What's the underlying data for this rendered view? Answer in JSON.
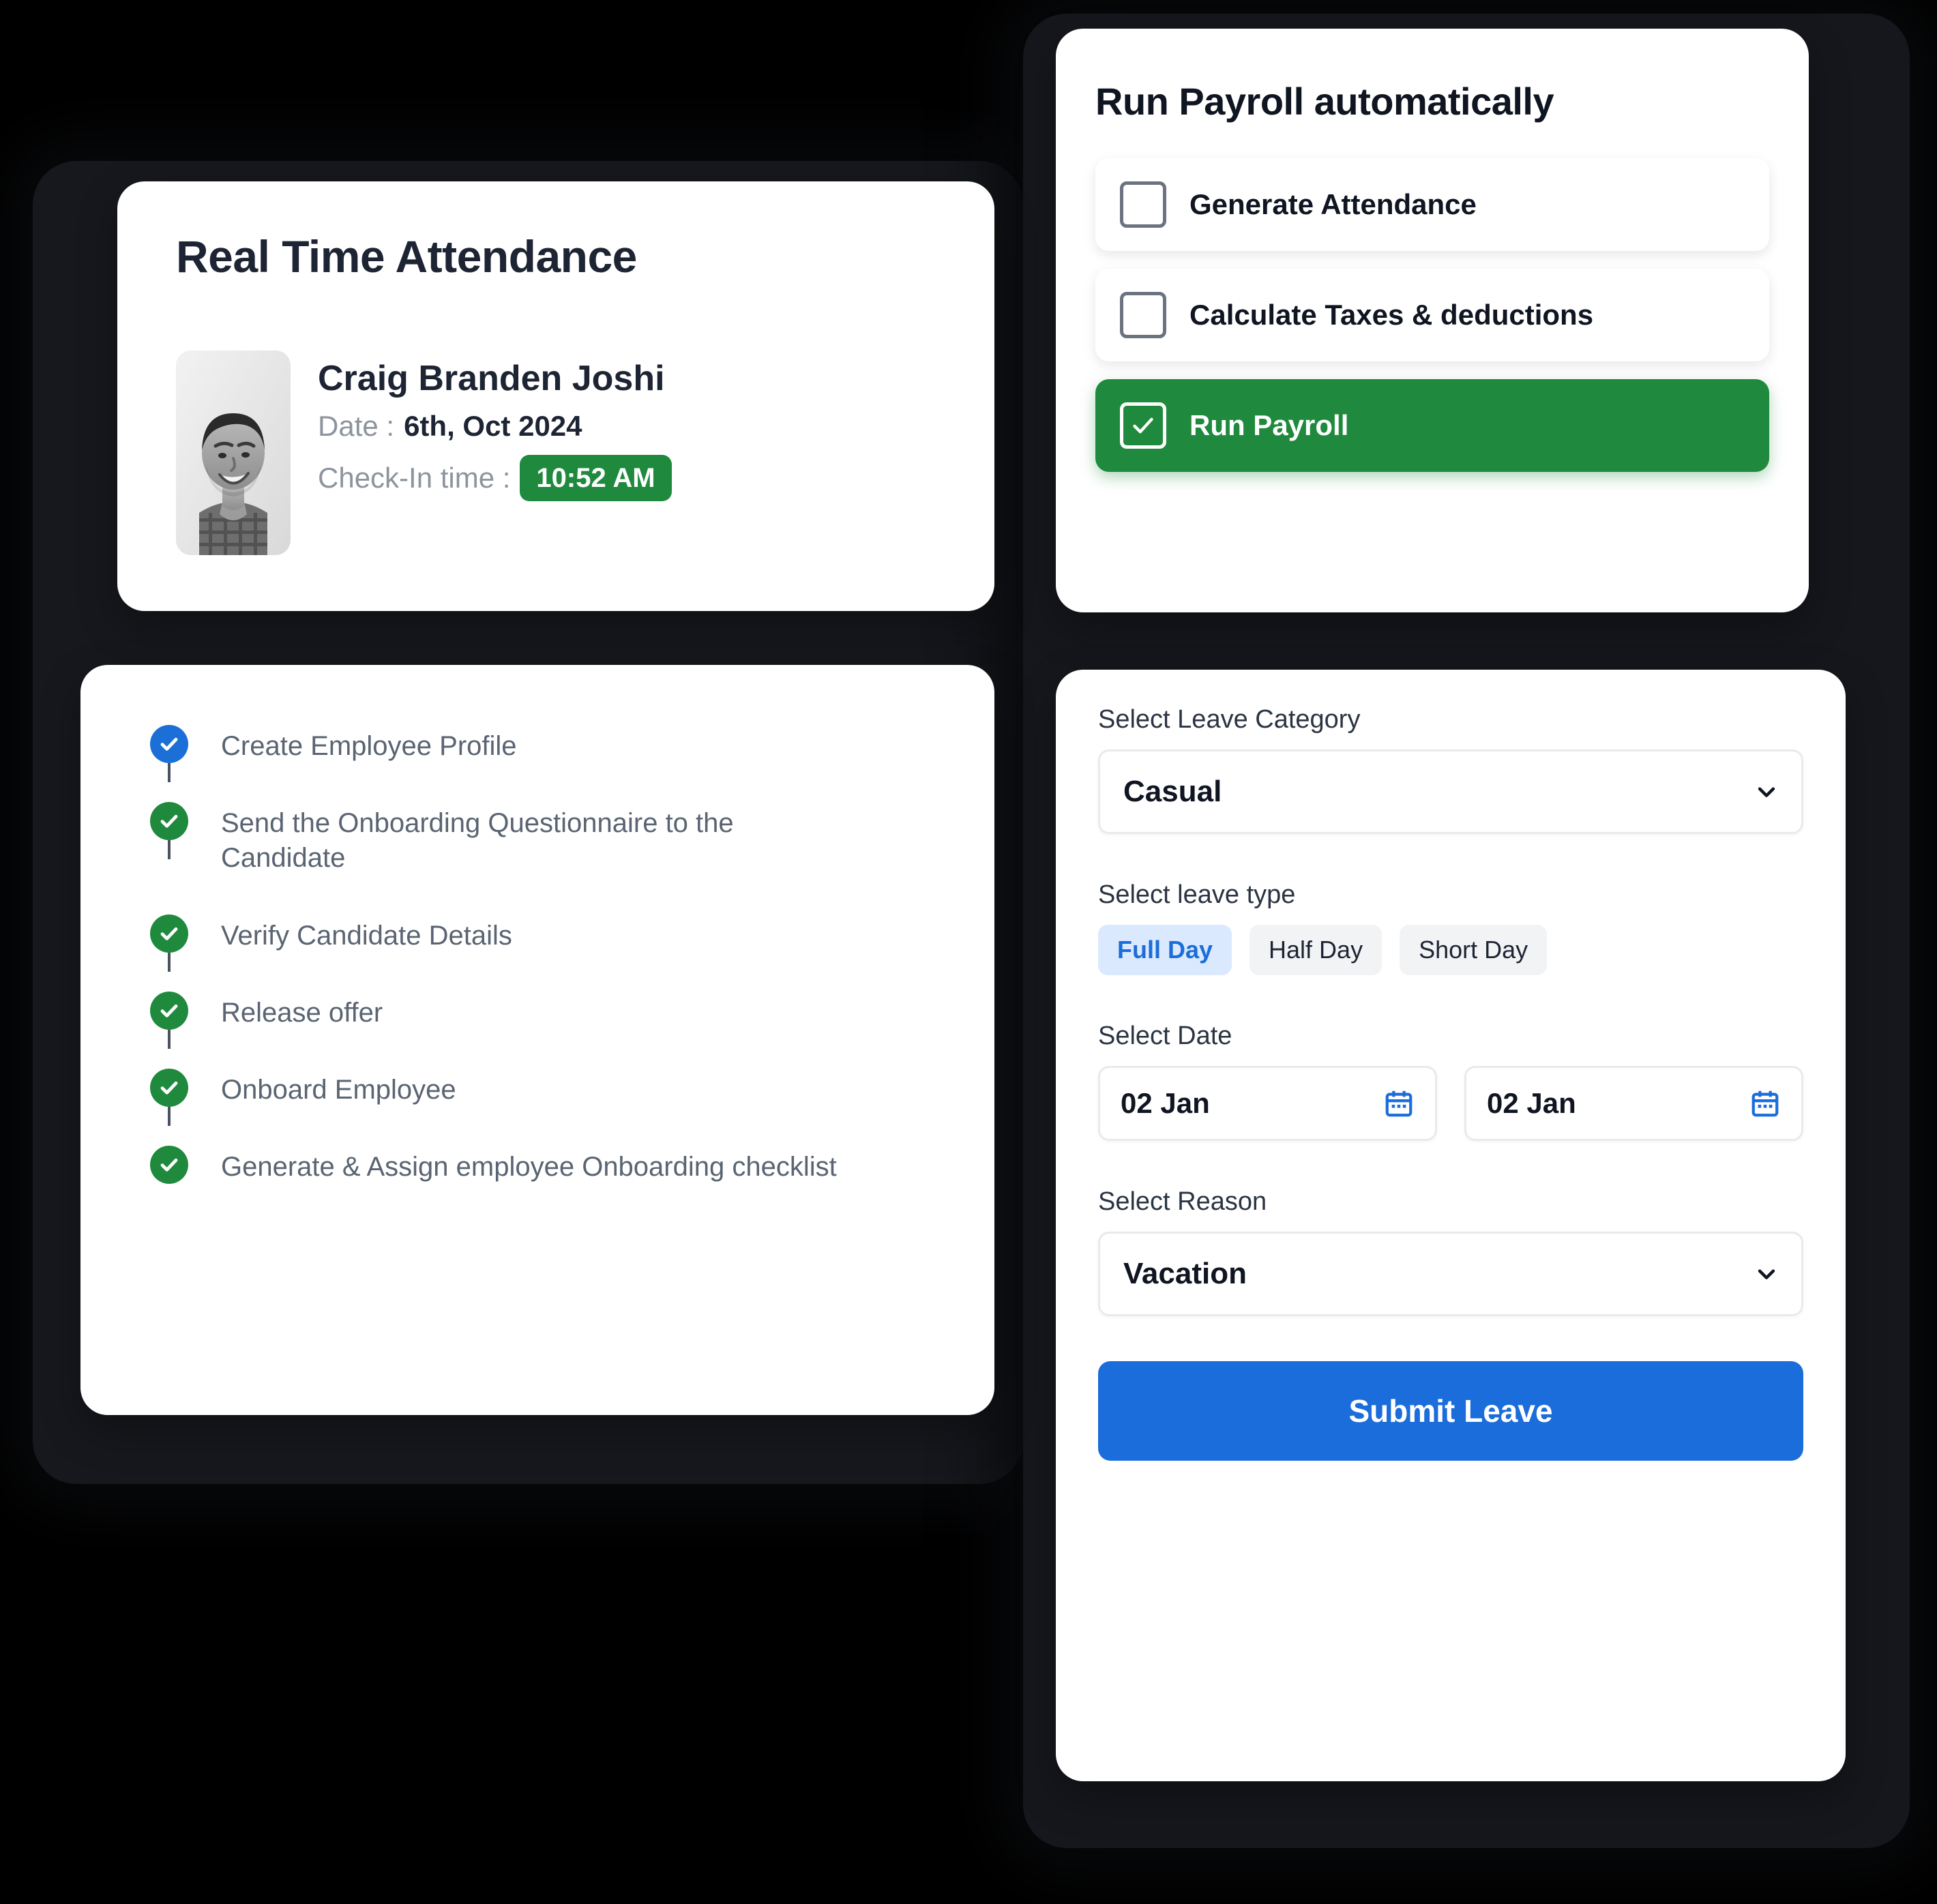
{
  "attendance": {
    "title": "Real Time Attendance",
    "employee_name": "Craig Branden Joshi",
    "date_label": "Date :",
    "date_value": "6th, Oct 2024",
    "checkin_label": "Check-In time :",
    "checkin_time": "10:52 AM",
    "avatar_alt": "employee-photo",
    "badge_color": "#1f8a3d"
  },
  "onboarding": {
    "steps": [
      {
        "label": "Create Employee Profile",
        "state": "current",
        "color": "#1c6fd6"
      },
      {
        "label": "Send the Onboarding Questionnaire to the Candidate",
        "state": "done",
        "color": "#1f8a3d"
      },
      {
        "label": "Verify Candidate Details",
        "state": "done",
        "color": "#1f8a3d"
      },
      {
        "label": "Release offer",
        "state": "done",
        "color": "#1f8a3d"
      },
      {
        "label": "Onboard Employee",
        "state": "done",
        "color": "#1f8a3d"
      },
      {
        "label": "Generate & Assign employee Onboarding checklist",
        "state": "done",
        "color": "#1f8a3d"
      }
    ]
  },
  "payroll": {
    "title": "Run Payroll automatically",
    "items": [
      {
        "label": "Generate Attendance",
        "checked": false
      },
      {
        "label": "Calculate Taxes & deductions",
        "checked": false
      },
      {
        "label": "Run Payroll",
        "checked": true
      }
    ],
    "active_color": "#1f8a3d"
  },
  "leave": {
    "category_label": "Select Leave Category",
    "category_value": "Casual",
    "type_label": "Select leave type",
    "types": [
      {
        "label": "Full Day",
        "selected": true
      },
      {
        "label": "Half Day",
        "selected": false
      },
      {
        "label": "Short Day",
        "selected": false
      }
    ],
    "date_label": "Select Date",
    "date_from": "02 Jan",
    "date_to": "02 Jan",
    "reason_label": "Select Reason",
    "reason_value": "Vacation",
    "submit_label": "Submit Leave",
    "accent_color": "#1b6ddb"
  }
}
